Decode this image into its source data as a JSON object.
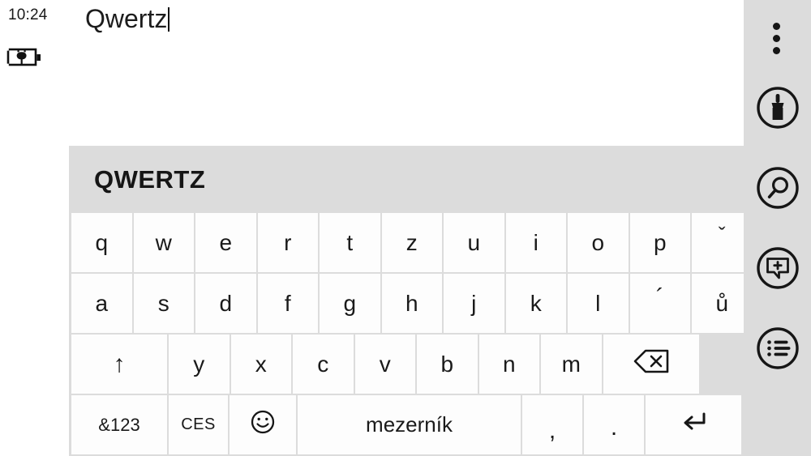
{
  "status": {
    "clock": "10:24",
    "battery_icon": "battery-charging-icon"
  },
  "document": {
    "text": "Qwertz",
    "caret_visible": true
  },
  "keyboard": {
    "title": "QWERTZ",
    "layout_name": "qwertz",
    "background_color": "#dcdcdc",
    "key_color": "#fdfdfd",
    "rows": [
      {
        "name": "row-1",
        "keys": [
          {
            "label": "q",
            "name": "key-q",
            "type": "letter"
          },
          {
            "label": "w",
            "name": "key-w",
            "type": "letter"
          },
          {
            "label": "e",
            "name": "key-e",
            "type": "letter"
          },
          {
            "label": "r",
            "name": "key-r",
            "type": "letter"
          },
          {
            "label": "t",
            "name": "key-t",
            "type": "letter"
          },
          {
            "label": "z",
            "name": "key-z",
            "type": "letter"
          },
          {
            "label": "u",
            "name": "key-u",
            "type": "letter"
          },
          {
            "label": "i",
            "name": "key-i",
            "type": "letter"
          },
          {
            "label": "o",
            "name": "key-o",
            "type": "letter"
          },
          {
            "label": "p",
            "name": "key-p",
            "type": "letter"
          },
          {
            "label": "ˇ",
            "name": "key-caron",
            "type": "diacritic"
          }
        ]
      },
      {
        "name": "row-2",
        "keys": [
          {
            "label": "a",
            "name": "key-a",
            "type": "letter"
          },
          {
            "label": "s",
            "name": "key-s",
            "type": "letter"
          },
          {
            "label": "d",
            "name": "key-d",
            "type": "letter"
          },
          {
            "label": "f",
            "name": "key-f",
            "type": "letter"
          },
          {
            "label": "g",
            "name": "key-g",
            "type": "letter"
          },
          {
            "label": "h",
            "name": "key-h",
            "type": "letter"
          },
          {
            "label": "j",
            "name": "key-j",
            "type": "letter"
          },
          {
            "label": "k",
            "name": "key-k",
            "type": "letter"
          },
          {
            "label": "l",
            "name": "key-l",
            "type": "letter"
          },
          {
            "label": "´",
            "name": "key-acute",
            "type": "diacritic"
          },
          {
            "label": "ů",
            "name": "key-u-ring",
            "type": "letter"
          }
        ]
      },
      {
        "name": "row-3",
        "keys": [
          {
            "label": "↑",
            "name": "key-shift",
            "type": "modifier"
          },
          {
            "label": "y",
            "name": "key-y",
            "type": "letter"
          },
          {
            "label": "x",
            "name": "key-x",
            "type": "letter"
          },
          {
            "label": "c",
            "name": "key-c",
            "type": "letter"
          },
          {
            "label": "v",
            "name": "key-v",
            "type": "letter"
          },
          {
            "label": "b",
            "name": "key-b",
            "type": "letter"
          },
          {
            "label": "n",
            "name": "key-n",
            "type": "letter"
          },
          {
            "label": "m",
            "name": "key-m",
            "type": "letter"
          },
          {
            "label": "⌫",
            "name": "key-backspace",
            "type": "action"
          }
        ]
      },
      {
        "name": "row-4",
        "keys": [
          {
            "label": "&123",
            "name": "key-symbols",
            "type": "action"
          },
          {
            "label": "CES",
            "name": "key-language",
            "type": "action"
          },
          {
            "label": "☺",
            "name": "key-emoji",
            "type": "action"
          },
          {
            "label": "mezerník",
            "name": "key-space",
            "type": "action"
          },
          {
            "label": ",",
            "name": "key-comma",
            "type": "punct"
          },
          {
            "label": ".",
            "name": "key-period",
            "type": "punct"
          },
          {
            "label": "↵",
            "name": "key-enter",
            "type": "action"
          }
        ]
      }
    ]
  },
  "sidebar": {
    "background_color": "#dcdcdc",
    "items": [
      {
        "name": "overflow-menu-button",
        "icon": "more-vertical-icon"
      },
      {
        "name": "brush-button",
        "icon": "paintbrush-icon"
      },
      {
        "name": "search-button",
        "icon": "search-icon"
      },
      {
        "name": "add-comment-button",
        "icon": "comment-plus-icon"
      },
      {
        "name": "list-button",
        "icon": "bullet-list-icon"
      }
    ]
  }
}
